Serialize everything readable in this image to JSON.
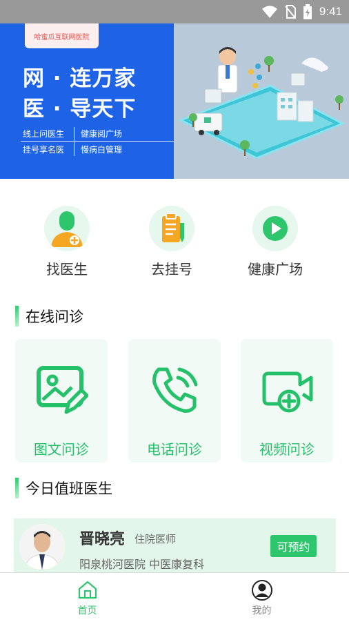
{
  "status_bar": {
    "time": "9:41"
  },
  "banner": {
    "hospital": "哈蜜瓜互联网医院",
    "slogan_line1": "网 · 连万家",
    "slogan_line2": "医 · 导天下",
    "features": [
      "线上问医生",
      "健康阅广场",
      "挂号享名医",
      "慢病白管理"
    ]
  },
  "quick_actions": [
    {
      "label": "找医生",
      "icon": "doctor-icon"
    },
    {
      "label": "去挂号",
      "icon": "clipboard-icon"
    },
    {
      "label": "健康广场",
      "icon": "play-icon"
    }
  ],
  "online_consult": {
    "title": "在线问诊",
    "items": [
      {
        "label": "图文问诊",
        "icon": "image-edit-icon"
      },
      {
        "label": "电话问诊",
        "icon": "phone-icon"
      },
      {
        "label": "视频问诊",
        "icon": "video-add-icon"
      }
    ]
  },
  "duty_doctors": {
    "title": "今日值班医生",
    "doctors": [
      {
        "name": "晋晓亮",
        "title": "住院医师",
        "hospital": "阳泉桃河医院 中医康复科",
        "action": "可预约"
      }
    ]
  },
  "tabbar": {
    "items": [
      {
        "label": "首页",
        "icon": "home-icon",
        "active": true
      },
      {
        "label": "我的",
        "icon": "user-icon",
        "active": false
      }
    ]
  },
  "colors": {
    "accent": "#2ec66d",
    "banner_blue": "#1e63e6",
    "active_tab": "#2ec66d",
    "inactive_tab": "#888888"
  }
}
